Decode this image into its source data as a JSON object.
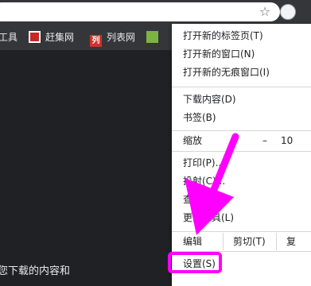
{
  "toolbar": {
    "star_icon": "star-icon",
    "star_glyph": "☆",
    "avatar_icon": "profile-avatar-icon"
  },
  "bookmarks": [
    {
      "label": "工具",
      "icon": ""
    },
    {
      "label": "赶集网",
      "icon": "ganji-logo-icon"
    },
    {
      "label": "列表网",
      "icon": "liebiao-logo-icon",
      "icon_text": "列"
    },
    {
      "label": "",
      "icon": "green-square-icon"
    }
  ],
  "menu": {
    "items_group1": [
      "打开新的标签页(T)",
      "打开新的窗口(N)",
      "打开新的无痕窗口(I)"
    ],
    "items_group2": [
      "下载内容(D)",
      "书签(B)"
    ],
    "zoom": {
      "label": "缩放",
      "minus": "–",
      "value": "10"
    },
    "items_group3": [
      "打印(P)...",
      "投射(C)...",
      "查找(F)...",
      "更多工具(L)"
    ],
    "edit": {
      "label": "编辑",
      "cut": "剪切(T)",
      "copy": "复"
    },
    "settings": "设置(S)"
  },
  "page": {
    "bottom_text": "您下载的内容和"
  },
  "annotation": {
    "color": "#ff00ff"
  }
}
